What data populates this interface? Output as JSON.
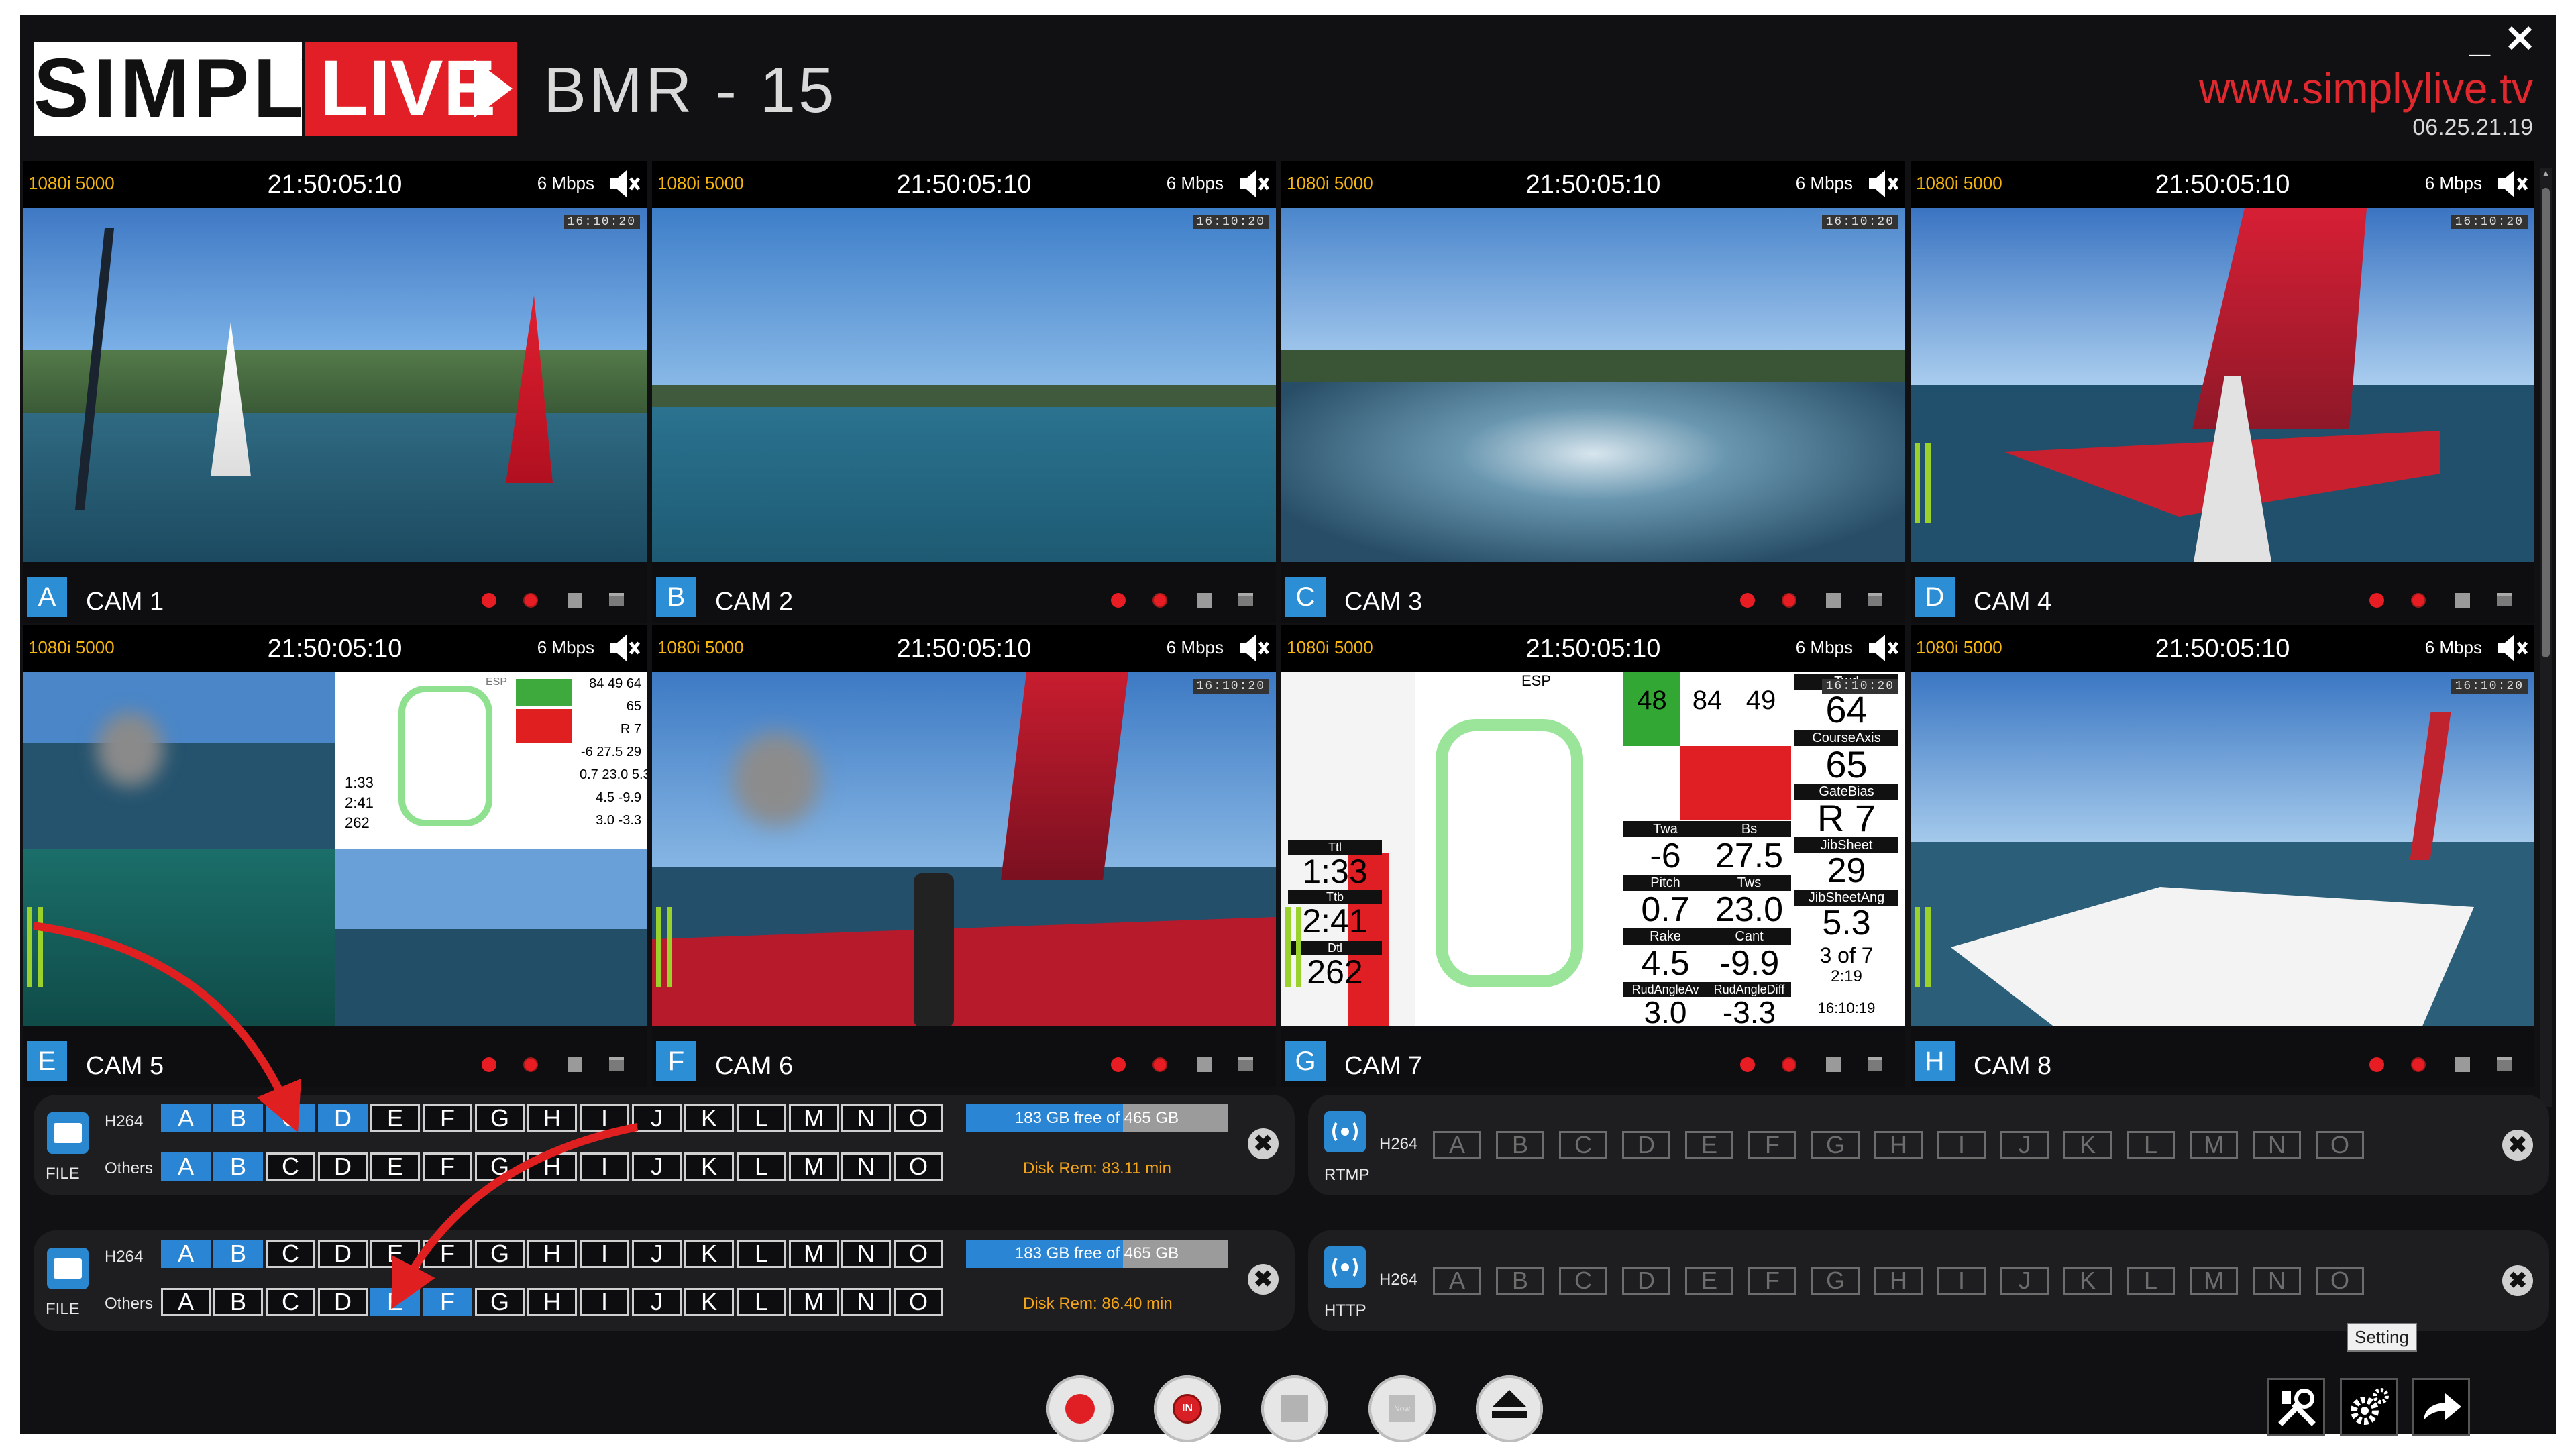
{
  "header": {
    "logo_simply": "SIMPLY",
    "logo_live": "LIVE",
    "title": "BMR - 15",
    "url": "www.simplylive.tv",
    "date": "06.25.21.19",
    "minimize": "_",
    "close": "✕"
  },
  "cameras": [
    {
      "format": "1080i 5000",
      "timecode": "21:50:05:10",
      "bitrate": "6 Mbps",
      "letter": "A",
      "name": "CAM 1",
      "stamp": "16:10:20"
    },
    {
      "format": "1080i 5000",
      "timecode": "21:50:05:10",
      "bitrate": "6 Mbps",
      "letter": "B",
      "name": "CAM 2",
      "stamp": "16:10:20"
    },
    {
      "format": "1080i 5000",
      "timecode": "21:50:05:10",
      "bitrate": "6 Mbps",
      "letter": "C",
      "name": "CAM 3",
      "stamp": "16:10:20"
    },
    {
      "format": "1080i 5000",
      "timecode": "21:50:05:10",
      "bitrate": "6 Mbps",
      "letter": "D",
      "name": "CAM 4",
      "stamp": "16:10:20"
    },
    {
      "format": "1080i 5000",
      "timecode": "21:50:05:10",
      "bitrate": "6 Mbps",
      "letter": "E",
      "name": "CAM 5",
      "stamp": ""
    },
    {
      "format": "1080i 5000",
      "timecode": "21:50:05:10",
      "bitrate": "6 Mbps",
      "letter": "F",
      "name": "CAM 6",
      "stamp": "16:10:20"
    },
    {
      "format": "1080i 5000",
      "timecode": "21:50:05:10",
      "bitrate": "6 Mbps",
      "letter": "G",
      "name": "CAM 7",
      "stamp": "16:10:20"
    },
    {
      "format": "1080i 5000",
      "timecode": "21:50:05:10",
      "bitrate": "6 Mbps",
      "letter": "H",
      "name": "CAM 8",
      "stamp": "16:10:20"
    }
  ],
  "telemetry_large": {
    "top": [
      "48",
      "84",
      "49",
      "Twd",
      "64"
    ],
    "course_axis_label": "CourseAxis",
    "course_axis": "65",
    "gate_bias_label": "GateBias",
    "gate_bias": "R 7",
    "twa_label": "Twa",
    "bs_label": "Bs",
    "jib_sheet_label": "JibSheet",
    "twa": "-6",
    "bs": "27.5",
    "jib_sheet": "29",
    "pitch_label": "Pitch",
    "tws_label": "Tws",
    "jib_sheet_ang_label": "JibSheetAng",
    "pitch": "0.7",
    "tws": "23.0",
    "jib_sheet_ang": "5.3",
    "rake_label": "Rake",
    "cant_label": "Cant",
    "rake": "4.5",
    "cant": "-9.9",
    "of": "3 of 7",
    "of_time": "2:19",
    "rud_label": "RudAngleAv",
    "rud_diff_label": "RudAngleDiff",
    "rud": "3.0",
    "rud_diff": "-3.3",
    "clock": "16:10:19",
    "ttl_label": "Ttl",
    "ttl": "1:33",
    "ttb_label": "Ttb",
    "ttb": "2:41",
    "dtl_label": "Dtl",
    "dtl": "262",
    "esp": "ESP"
  },
  "telemetry_small": {
    "r1": [
      "84",
      "49",
      "64"
    ],
    "r2": "65",
    "r3": "R 7",
    "r4": [
      "-6",
      "27.5",
      "29"
    ],
    "r5": [
      "0.7",
      "23.0",
      "5.3"
    ],
    "r6": [
      "4.5",
      "-9.9"
    ],
    "r7": [
      "3.0",
      "-3.3"
    ],
    "left": [
      "1:33",
      "2:41",
      "262"
    ],
    "esp": "ESP"
  },
  "slot_letters": [
    "A",
    "B",
    "C",
    "D",
    "E",
    "F",
    "G",
    "H",
    "I",
    "J",
    "K",
    "L",
    "M",
    "N",
    "O"
  ],
  "file_panels": [
    {
      "icon_label": "FILE",
      "row1_label": "H264",
      "row2_label": "Others",
      "row1_on": [
        0,
        1,
        2,
        3
      ],
      "row2_on": [
        0,
        1
      ],
      "disk_text": "183 GB free of 465 GB",
      "disk_used_fraction": 0.6,
      "disk_rem": "Disk Rem: 83.11 min",
      "close": "✖"
    },
    {
      "icon_label": "FILE",
      "row1_label": "H264",
      "row2_label": "Others",
      "row1_on": [
        0,
        1
      ],
      "row2_on": [
        4,
        5
      ],
      "disk_text": "183 GB free of 465 GB",
      "disk_used_fraction": 0.6,
      "disk_rem": "Disk Rem: 86.40 min",
      "close": "✖"
    }
  ],
  "stream_panels": [
    {
      "icon_label": "RTMP",
      "row_label": "H264",
      "close": "✖"
    },
    {
      "icon_label": "HTTP",
      "row_label": "H264",
      "close": "✖"
    }
  ],
  "transport": {
    "in_label": "IN",
    "now_label": "Now"
  },
  "tooltip": "Setting",
  "colors": {
    "accent": "#2a86d4",
    "brand_red": "#e21f26",
    "format_text": "#f6b50e",
    "disk_rem": "#f2a51a",
    "arrow": "#e02020"
  },
  "icons": [
    "folder-icon",
    "broadcast-icon",
    "record-icon",
    "in-record-icon",
    "stop-icon",
    "now-icon",
    "eject-icon",
    "tools-icon",
    "gear-icon",
    "exit-arrow-icon",
    "mute-icon",
    "close-icon"
  ]
}
